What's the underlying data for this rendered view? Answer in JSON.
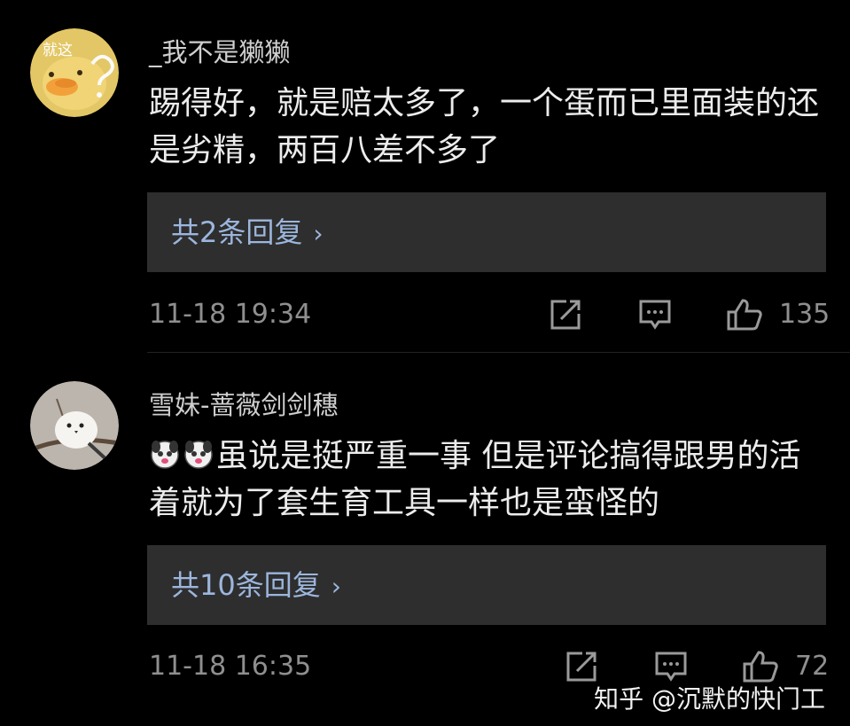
{
  "comments": [
    {
      "avatar_text": "就这",
      "username": "_我不是獭獭",
      "text": "踢得好，就是赔太多了，一个蛋而已里面装的还是劣精，两百八差不多了",
      "replies_label": "共2条回复",
      "reply_chevron": "›",
      "timestamp": "11-18 19:34",
      "like_count": "135"
    },
    {
      "username": "雪妹-蔷薇剑剑穗",
      "text": "虽说是挺严重一事 但是评论搞得跟男的活着就为了套生育工具一样也是蛮怪的",
      "replies_label": "共10条回复",
      "reply_chevron": "›",
      "timestamp": "11-18 16:35",
      "like_count": "72"
    }
  ],
  "watermark": "知乎 @沉默的快门工",
  "icons": [
    "share-icon",
    "comment-icon",
    "like-icon",
    "dog-emoji-icon",
    "duck-avatar",
    "bird-avatar"
  ],
  "colors": {
    "background": "#000000",
    "reply_box": "#2e2e2e",
    "link": "#9cb6dd",
    "meta": "#8f8f8f"
  }
}
